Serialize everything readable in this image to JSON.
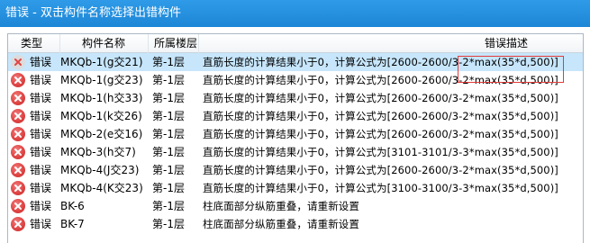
{
  "window": {
    "title": "错误 - 双击构件名称选择出错构件"
  },
  "columns": {
    "type": "类型",
    "name": "构件名称",
    "floor": "所属楼层",
    "desc": "错误描述"
  },
  "rows": [
    {
      "type": "错误",
      "name": "MKQb-1(g交21)",
      "floor": "第-1层",
      "desc": "直筋长度的计算结果小于0，计算公式为[2600-2600/3-2*max(35*d,500)]",
      "selected": true
    },
    {
      "type": "错误",
      "name": "MKQb-1(g交23)",
      "floor": "第-1层",
      "desc": "直筋长度的计算结果小于0，计算公式为[2600-2600/3-2*max(35*d,500)]"
    },
    {
      "type": "错误",
      "name": "MKQb-1(h交33)",
      "floor": "第-1层",
      "desc": "直筋长度的计算结果小于0，计算公式为[2600-2600/3-2*max(35*d,500)]"
    },
    {
      "type": "错误",
      "name": "MKQb-1(k交26)",
      "floor": "第-1层",
      "desc": "直筋长度的计算结果小于0，计算公式为[2600-2600/3-2*max(35*d,500)]"
    },
    {
      "type": "错误",
      "name": "MKQb-2(e交16)",
      "floor": "第-1层",
      "desc": "直筋长度的计算结果小于0，计算公式为[2600-2600/3-2*max(35*d,500)]"
    },
    {
      "type": "错误",
      "name": "MKQb-3(h交7)",
      "floor": "第-1层",
      "desc": "直筋长度的计算结果小于0，计算公式为[3101-3101/3-3*max(35*d,500)]"
    },
    {
      "type": "错误",
      "name": "MKQb-4(J交23)",
      "floor": "第-1层",
      "desc": "直筋长度的计算结果小于0，计算公式为[2600-2600/3-2*max(35*d,500)]"
    },
    {
      "type": "错误",
      "name": "MKQb-4(K交23)",
      "floor": "第-1层",
      "desc": "直筋长度的计算结果小于0，计算公式为[3100-3100/3-3*max(35*d,500)]"
    },
    {
      "type": "错误",
      "name": "BK-6",
      "floor": "第-1层",
      "desc": "柱底面部分纵筋重叠，请重新设置"
    },
    {
      "type": "错误",
      "name": "BK-7",
      "floor": "第-1层",
      "desc": "柱底面部分纵筋重叠，请重新设置"
    }
  ],
  "icons": {
    "row_icon": "error-icon",
    "error_color": "#e04545"
  }
}
